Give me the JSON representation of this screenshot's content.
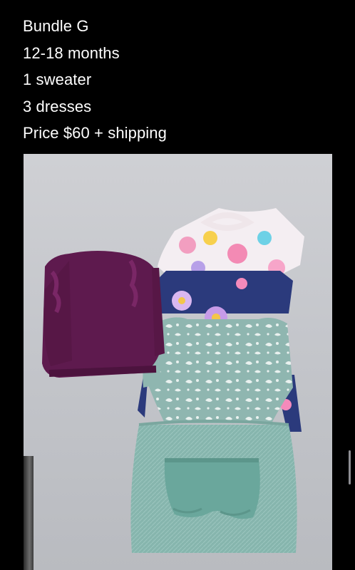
{
  "post": {
    "lines": [
      "Bundle G",
      "12-18 months",
      "1 sweater",
      "3 dresses",
      "Price $60 + shipping"
    ]
  },
  "photo": {
    "items": [
      "sweater",
      "floral-dress",
      "floral-dress",
      "unicorn-tutu-dress",
      "bloomers"
    ],
    "colors": {
      "background": "#000000",
      "text": "#ffffff",
      "surface": "#c9cacf",
      "sweater": "#5e1a4e",
      "navy_dress": "#2b3a7c",
      "mint_dress": "#8fb6b0",
      "tulle": "#86b5ad",
      "bloomers": "#6aa79c"
    }
  }
}
